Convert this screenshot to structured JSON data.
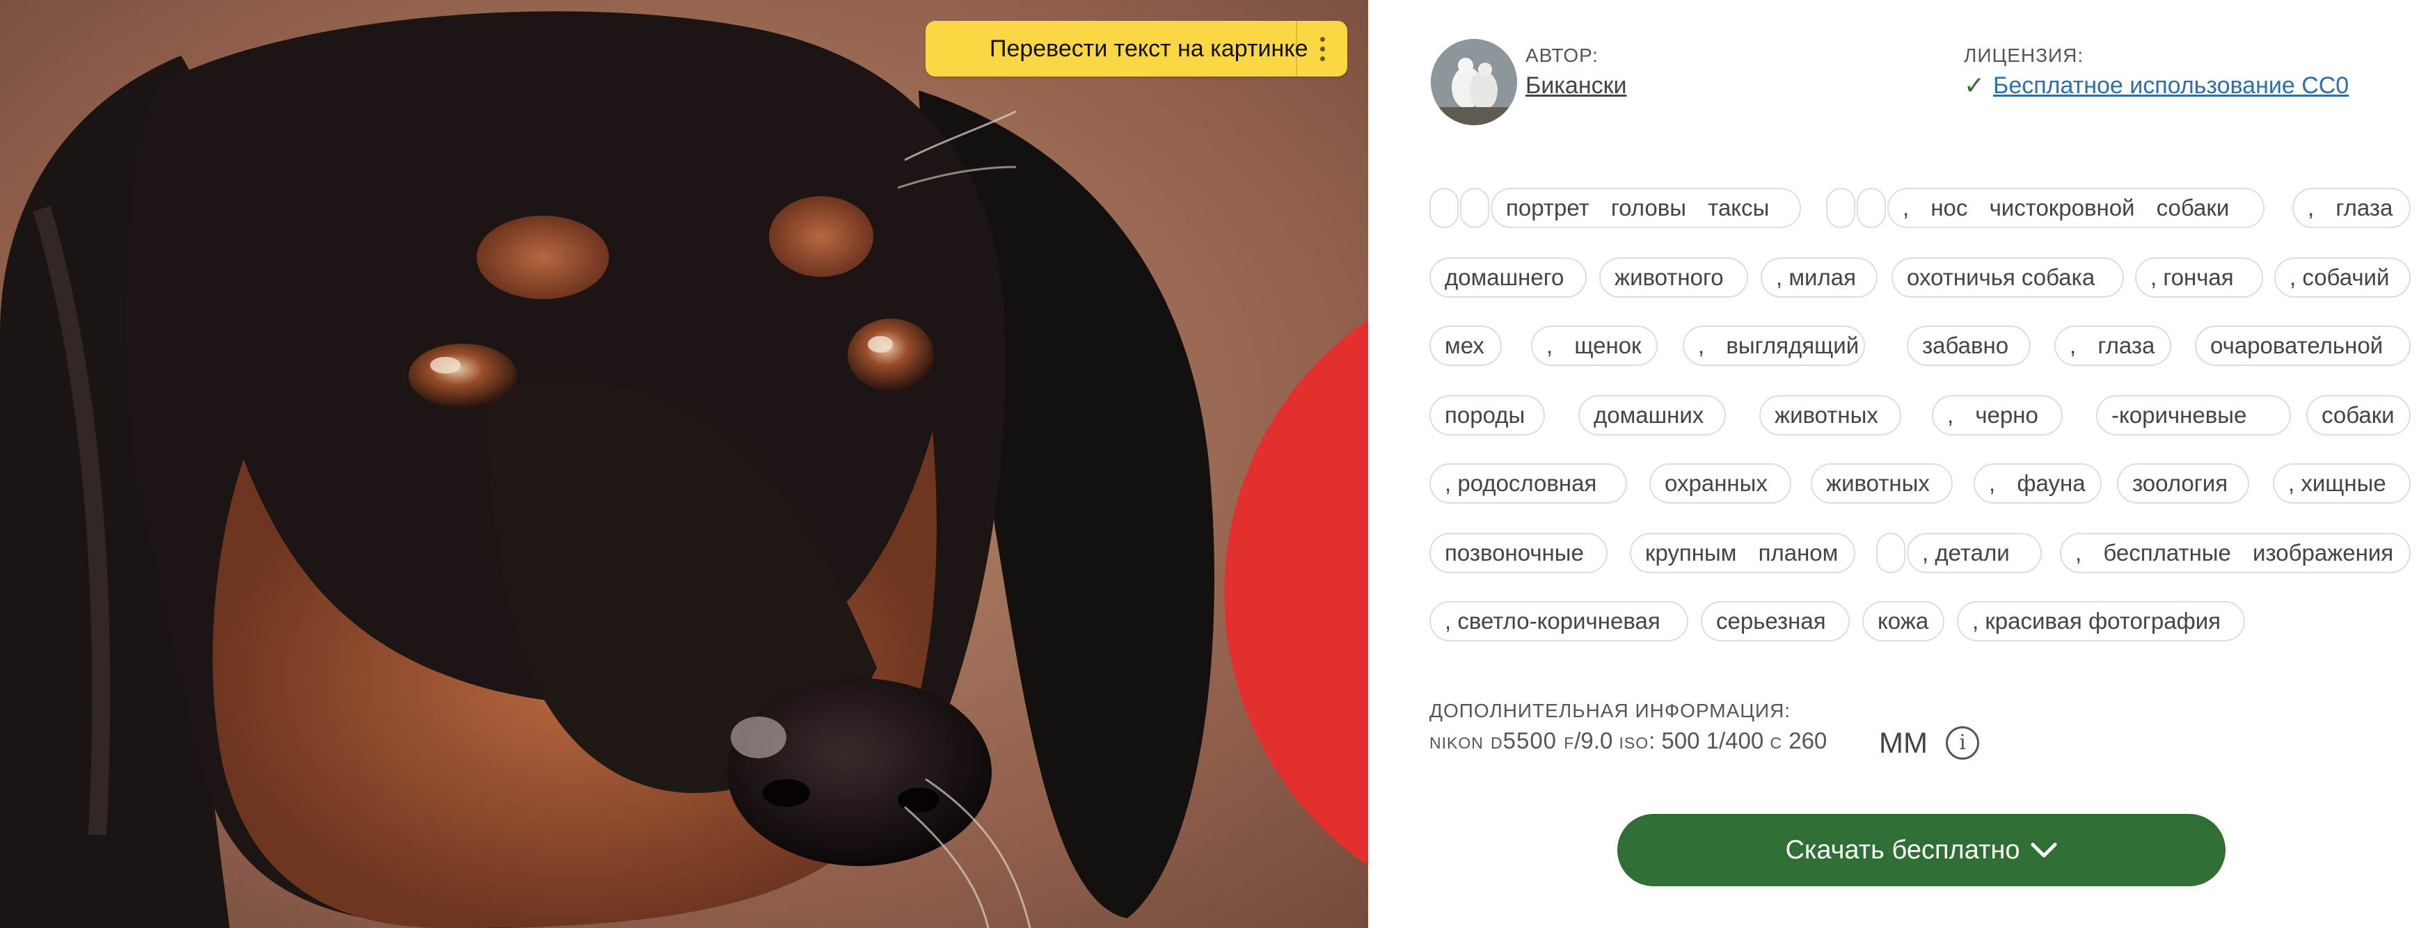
{
  "translate_bar": {
    "label": "Перевести текст на картинке",
    "icon": "translate-icon",
    "menu_icon": "more-vertical-icon"
  },
  "author": {
    "caption": "АВТОР:",
    "name": "Бикански"
  },
  "license": {
    "caption": "ЛИЦЕНЗИЯ:",
    "check": "✓",
    "name": "Бесплатное использование CC0"
  },
  "tags": [
    "",
    "",
    "портрет головы таксы",
    "",
    "",
    ", нос чистокровной собаки",
    ", глаза",
    "домашнего",
    "животного",
    ", милая",
    "охотничья собака",
    ", гончая",
    ", собачий",
    "мех",
    ", щенок",
    ", выглядящий",
    "забавно",
    ", глаза",
    "очаровательной",
    "породы",
    "домашних",
    "животных",
    ", черно",
    "-коричневые",
    "собаки",
    ", родословная",
    "охранных",
    "животных",
    ", фауна",
    "зоология",
    ", хищные",
    "позвоночные",
    "крупным планом",
    "",
    ", детали",
    ", бесплатные изображения",
    ", светло-коричневая",
    "серьезная",
    "кожа",
    ", красивая фотография"
  ],
  "extra_info": {
    "caption": "ДОПОЛНИТЕЛЬНАЯ ИНФОРМАЦИЯ:",
    "camera_prefix": "nikon d5500 f",
    "aperture": "/9.0",
    "iso_prefix": "iso",
    "iso_value": ": 500 1/400",
    "shutter_unit": "с",
    "focal_length": "260",
    "unit": "ММ",
    "info_glyph": "i"
  },
  "download": {
    "label": "Скачать бесплатно"
  },
  "colors": {
    "accent_green": "#2f6e34",
    "translate_yellow": "#fbd743",
    "link_blue": "#2a6fa8"
  }
}
